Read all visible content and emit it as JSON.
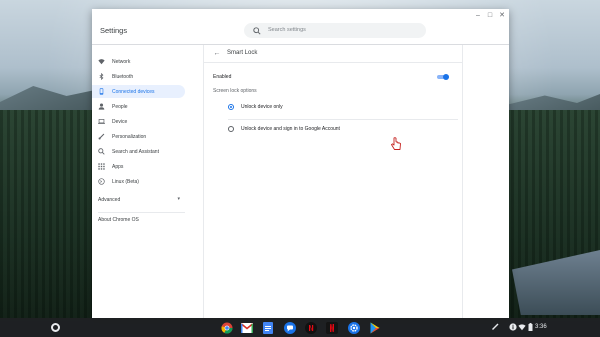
{
  "window": {
    "title": "Settings",
    "search_placeholder": "Search settings",
    "controls": {
      "minimize": "–",
      "maximize": "□",
      "close": "✕"
    }
  },
  "sidebar": {
    "items": [
      {
        "label": "Network",
        "icon": "wifi-icon"
      },
      {
        "label": "Bluetooth",
        "icon": "bluetooth-icon"
      },
      {
        "label": "Connected devices",
        "icon": "phone-icon",
        "active": true
      },
      {
        "label": "People",
        "icon": "person-icon"
      },
      {
        "label": "Device",
        "icon": "laptop-icon"
      },
      {
        "label": "Personalization",
        "icon": "brush-icon"
      },
      {
        "label": "Search and Assistant",
        "icon": "search-icon"
      },
      {
        "label": "Apps",
        "icon": "grid-icon"
      },
      {
        "label": "Linux (Beta)",
        "icon": "terminal-icon"
      }
    ],
    "advanced_label": "Advanced",
    "advanced_chevron": "▾",
    "about_label": "About Chrome OS"
  },
  "main": {
    "back_glyph": "←",
    "title": "Smart Lock",
    "enabled_label": "Enabled",
    "enabled": true,
    "options_label": "Screen lock options",
    "options": [
      {
        "label": "Unlock device only",
        "checked": true
      },
      {
        "label": "Unlock device and sign in to Google Account",
        "checked": false
      }
    ]
  },
  "shelf": {
    "apps": [
      "chrome-icon",
      "gmail-icon",
      "docs-icon",
      "messages-icon",
      "netflix-icon",
      "settings-icon",
      "play-store-icon"
    ],
    "time": "3:36"
  },
  "colors": {
    "accent": "#1a73e8",
    "active_bg": "#e8f0fe"
  }
}
